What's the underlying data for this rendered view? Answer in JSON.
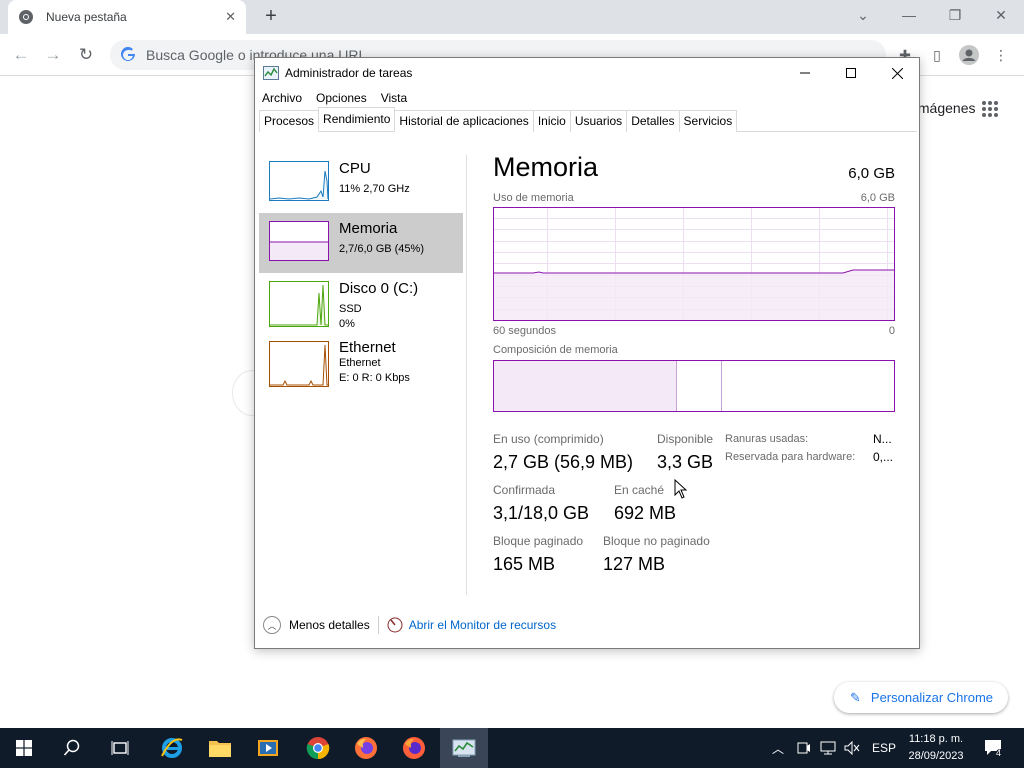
{
  "browser": {
    "tab_title": "Nueva pestaña",
    "tab_close": "✕",
    "new_tab": "+",
    "omnibox_placeholder": "Busca Google o introduce una URL",
    "images_link": "Imágenes",
    "customize": "Personalizar Chrome"
  },
  "taskmgr": {
    "title": "Administrador de tareas",
    "menu": [
      "Archivo",
      "Opciones",
      "Vista"
    ],
    "tabs": [
      "Procesos",
      "Rendimiento",
      "Historial de aplicaciones",
      "Inicio",
      "Usuarios",
      "Detalles",
      "Servicios"
    ],
    "active_tab": "Rendimiento",
    "sidebar": [
      {
        "name": "CPU",
        "line1": "11%  2,70 GHz",
        "line2": "",
        "color": "#1a7bbf",
        "selected": false
      },
      {
        "name": "Memoria",
        "line1": "2,7/6,0 GB (45%)",
        "line2": "",
        "color": "#8b12ae",
        "selected": true
      },
      {
        "name": "Disco 0 (C:)",
        "line1": "SSD",
        "line2": "0%",
        "color": "#4da60c",
        "selected": false
      },
      {
        "name": "Ethernet",
        "line1": "Ethernet",
        "line2": "E: 0  R: 0 Kbps",
        "color": "#a74f01",
        "selected": false
      }
    ],
    "detail": {
      "title": "Memoria",
      "total": "6,0 GB",
      "usage_label": "Uso de memoria",
      "usage_max": "6,0 GB",
      "time_left": "60 segundos",
      "time_right": "0",
      "composition_label": "Composición de memoria",
      "usage_fraction": 0.45,
      "stats": {
        "in_use_label": "En uso (comprimido)",
        "in_use_value": "2,7 GB (56,9 MB)",
        "available_label": "Disponible",
        "available_value": "3,3 GB",
        "committed_label": "Confirmada",
        "committed_value": "3,1/18,0 GB",
        "cached_label": "En caché",
        "cached_value": "692 MB",
        "paged_label": "Bloque paginado",
        "paged_value": "165 MB",
        "nonpaged_label": "Bloque no paginado",
        "nonpaged_value": "127 MB",
        "slots_label": "Ranuras usadas:",
        "slots_value": "N...",
        "reserved_label": "Reservada para hardware:",
        "reserved_value": "0,..."
      }
    },
    "footer": {
      "fewer_details": "Menos detalles",
      "resource_monitor": "Abrir el Monitor de recursos"
    }
  },
  "taskbar": {
    "language": "ESP",
    "time": "11:18 p. m.",
    "date": "28/09/2023",
    "notification_count": "4"
  }
}
